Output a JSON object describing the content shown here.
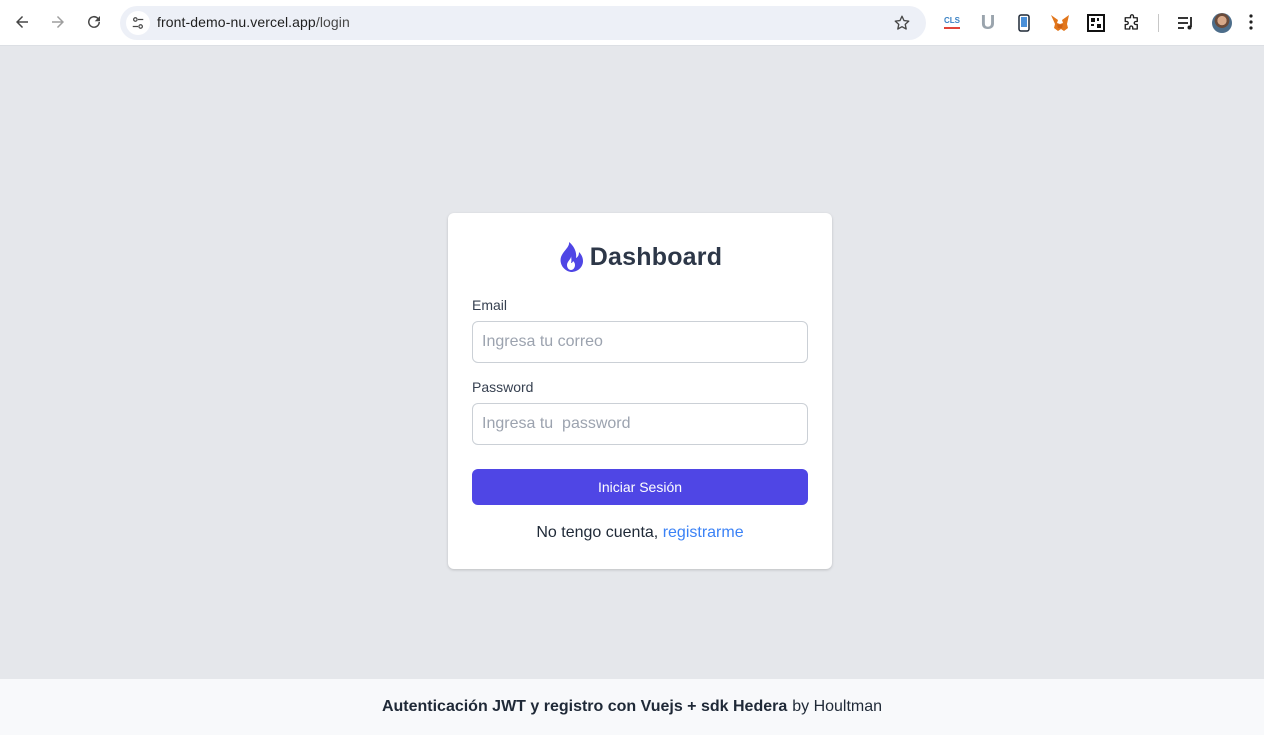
{
  "browser": {
    "url_host": "front-demo-nu.vercel.app",
    "url_path": "/login",
    "extensions": [
      "CLS",
      "U"
    ]
  },
  "login": {
    "brand_title": "Dashboard",
    "email_label": "Email",
    "email_placeholder": "Ingresa tu correo",
    "password_label": "Password",
    "password_placeholder": "Ingresa tu  password",
    "submit_label": "Iniciar Sesión",
    "no_account_text": "No tengo cuenta,",
    "register_link": "registrarme"
  },
  "footer": {
    "title": "Autenticación JWT y registro con Vuejs + sdk Hedera",
    "author": "by Houltman"
  },
  "colors": {
    "primary_button": "#4f46e5",
    "link": "#3b82f6",
    "page_background": "#e5e7eb",
    "brand_flame": "#4f46e5"
  }
}
